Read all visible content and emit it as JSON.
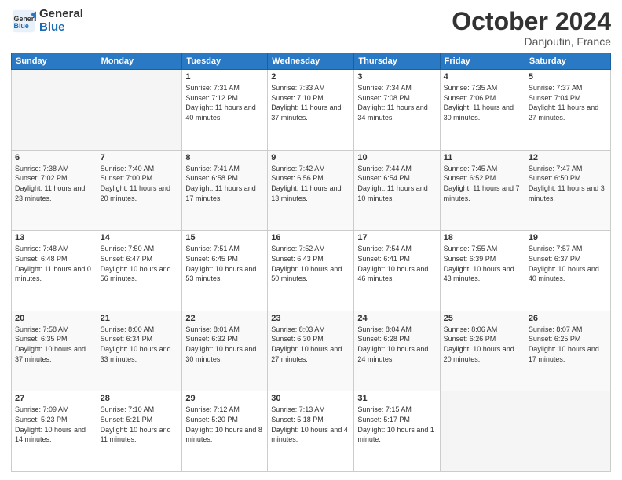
{
  "header": {
    "logo_line1": "General",
    "logo_line2": "Blue",
    "month": "October 2024",
    "location": "Danjoutin, France"
  },
  "days_of_week": [
    "Sunday",
    "Monday",
    "Tuesday",
    "Wednesday",
    "Thursday",
    "Friday",
    "Saturday"
  ],
  "weeks": [
    [
      {
        "day": "",
        "info": ""
      },
      {
        "day": "",
        "info": ""
      },
      {
        "day": "1",
        "info": "Sunrise: 7:31 AM\nSunset: 7:12 PM\nDaylight: 11 hours and 40 minutes."
      },
      {
        "day": "2",
        "info": "Sunrise: 7:33 AM\nSunset: 7:10 PM\nDaylight: 11 hours and 37 minutes."
      },
      {
        "day": "3",
        "info": "Sunrise: 7:34 AM\nSunset: 7:08 PM\nDaylight: 11 hours and 34 minutes."
      },
      {
        "day": "4",
        "info": "Sunrise: 7:35 AM\nSunset: 7:06 PM\nDaylight: 11 hours and 30 minutes."
      },
      {
        "day": "5",
        "info": "Sunrise: 7:37 AM\nSunset: 7:04 PM\nDaylight: 11 hours and 27 minutes."
      }
    ],
    [
      {
        "day": "6",
        "info": "Sunrise: 7:38 AM\nSunset: 7:02 PM\nDaylight: 11 hours and 23 minutes."
      },
      {
        "day": "7",
        "info": "Sunrise: 7:40 AM\nSunset: 7:00 PM\nDaylight: 11 hours and 20 minutes."
      },
      {
        "day": "8",
        "info": "Sunrise: 7:41 AM\nSunset: 6:58 PM\nDaylight: 11 hours and 17 minutes."
      },
      {
        "day": "9",
        "info": "Sunrise: 7:42 AM\nSunset: 6:56 PM\nDaylight: 11 hours and 13 minutes."
      },
      {
        "day": "10",
        "info": "Sunrise: 7:44 AM\nSunset: 6:54 PM\nDaylight: 11 hours and 10 minutes."
      },
      {
        "day": "11",
        "info": "Sunrise: 7:45 AM\nSunset: 6:52 PM\nDaylight: 11 hours and 7 minutes."
      },
      {
        "day": "12",
        "info": "Sunrise: 7:47 AM\nSunset: 6:50 PM\nDaylight: 11 hours and 3 minutes."
      }
    ],
    [
      {
        "day": "13",
        "info": "Sunrise: 7:48 AM\nSunset: 6:48 PM\nDaylight: 11 hours and 0 minutes."
      },
      {
        "day": "14",
        "info": "Sunrise: 7:50 AM\nSunset: 6:47 PM\nDaylight: 10 hours and 56 minutes."
      },
      {
        "day": "15",
        "info": "Sunrise: 7:51 AM\nSunset: 6:45 PM\nDaylight: 10 hours and 53 minutes."
      },
      {
        "day": "16",
        "info": "Sunrise: 7:52 AM\nSunset: 6:43 PM\nDaylight: 10 hours and 50 minutes."
      },
      {
        "day": "17",
        "info": "Sunrise: 7:54 AM\nSunset: 6:41 PM\nDaylight: 10 hours and 46 minutes."
      },
      {
        "day": "18",
        "info": "Sunrise: 7:55 AM\nSunset: 6:39 PM\nDaylight: 10 hours and 43 minutes."
      },
      {
        "day": "19",
        "info": "Sunrise: 7:57 AM\nSunset: 6:37 PM\nDaylight: 10 hours and 40 minutes."
      }
    ],
    [
      {
        "day": "20",
        "info": "Sunrise: 7:58 AM\nSunset: 6:35 PM\nDaylight: 10 hours and 37 minutes."
      },
      {
        "day": "21",
        "info": "Sunrise: 8:00 AM\nSunset: 6:34 PM\nDaylight: 10 hours and 33 minutes."
      },
      {
        "day": "22",
        "info": "Sunrise: 8:01 AM\nSunset: 6:32 PM\nDaylight: 10 hours and 30 minutes."
      },
      {
        "day": "23",
        "info": "Sunrise: 8:03 AM\nSunset: 6:30 PM\nDaylight: 10 hours and 27 minutes."
      },
      {
        "day": "24",
        "info": "Sunrise: 8:04 AM\nSunset: 6:28 PM\nDaylight: 10 hours and 24 minutes."
      },
      {
        "day": "25",
        "info": "Sunrise: 8:06 AM\nSunset: 6:26 PM\nDaylight: 10 hours and 20 minutes."
      },
      {
        "day": "26",
        "info": "Sunrise: 8:07 AM\nSunset: 6:25 PM\nDaylight: 10 hours and 17 minutes."
      }
    ],
    [
      {
        "day": "27",
        "info": "Sunrise: 7:09 AM\nSunset: 5:23 PM\nDaylight: 10 hours and 14 minutes."
      },
      {
        "day": "28",
        "info": "Sunrise: 7:10 AM\nSunset: 5:21 PM\nDaylight: 10 hours and 11 minutes."
      },
      {
        "day": "29",
        "info": "Sunrise: 7:12 AM\nSunset: 5:20 PM\nDaylight: 10 hours and 8 minutes."
      },
      {
        "day": "30",
        "info": "Sunrise: 7:13 AM\nSunset: 5:18 PM\nDaylight: 10 hours and 4 minutes."
      },
      {
        "day": "31",
        "info": "Sunrise: 7:15 AM\nSunset: 5:17 PM\nDaylight: 10 hours and 1 minute."
      },
      {
        "day": "",
        "info": ""
      },
      {
        "day": "",
        "info": ""
      }
    ]
  ]
}
